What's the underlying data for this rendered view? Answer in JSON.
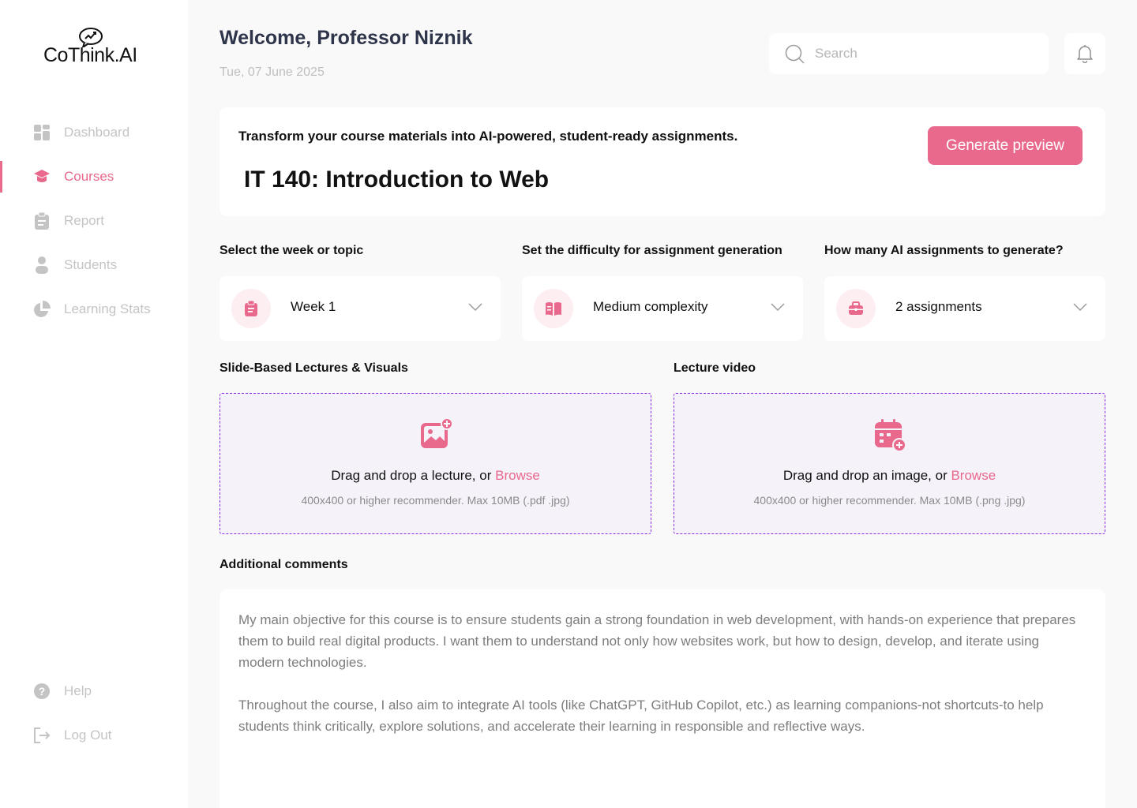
{
  "brand": {
    "name": "CoThink.AI"
  },
  "sidebar": {
    "items": [
      {
        "label": "Dashboard",
        "icon": "grid-icon"
      },
      {
        "label": "Courses",
        "icon": "graduation-cap-icon",
        "active": true
      },
      {
        "label": "Report",
        "icon": "clipboard-icon"
      },
      {
        "label": "Students",
        "icon": "user-icon"
      },
      {
        "label": "Learning Stats",
        "icon": "pie-chart-icon"
      }
    ],
    "footer": [
      {
        "label": "Help",
        "icon": "help-icon"
      },
      {
        "label": "Log Out",
        "icon": "logout-icon"
      }
    ]
  },
  "header": {
    "welcome": "Welcome, Professor Niznik",
    "date": "Tue, 07 June 2025",
    "search_placeholder": "Search"
  },
  "hero": {
    "tagline": "Transform your course materials into AI-powered, student-ready assignments.",
    "course_title": "IT 140: Introduction to Web",
    "generate_label": "Generate preview"
  },
  "selects": [
    {
      "label": "Select the week or topic",
      "value": "Week 1",
      "icon": "clipboard-icon"
    },
    {
      "label": "Set the difficulty for assignment generation",
      "value": "Medium complexity",
      "icon": "book-icon"
    },
    {
      "label": "How many AI assignments to generate?",
      "value": "2 assignments",
      "icon": "briefcase-icon"
    }
  ],
  "uploads": [
    {
      "label": "Slide-Based Lectures & Visuals",
      "main": "Drag and drop a lecture, or ",
      "browse": "Browse",
      "sub": "400x400 or higher recommender. Max 10MB (.pdf .jpg)",
      "icon": "image-add-icon"
    },
    {
      "label": "Lecture video",
      "main": "Drag and drop an image, or ",
      "browse": "Browse",
      "sub": "400x400 or higher recommender. Max 10MB (.png .jpg)",
      "icon": "calendar-add-icon"
    }
  ],
  "comments": {
    "label": "Additional comments",
    "paragraphs": [
      "My main objective for this course is to ensure students gain a strong foundation in web development, with hands-on experience that prepares them to build real digital products. I want them to understand not only how websites work, but how to design, develop, and iterate using modern technologies.",
      "Throughout the course, I also aim to integrate AI tools (like ChatGPT, GitHub Copilot, etc.) as learning companions-not shortcuts-to help students think critically, explore solutions, and accelerate their learning in responsible and reflective ways."
    ]
  },
  "colors": {
    "accent": "#e8698c",
    "sidebar_inactive": "#c4c4c4",
    "upload_border": "#8a2be2"
  }
}
